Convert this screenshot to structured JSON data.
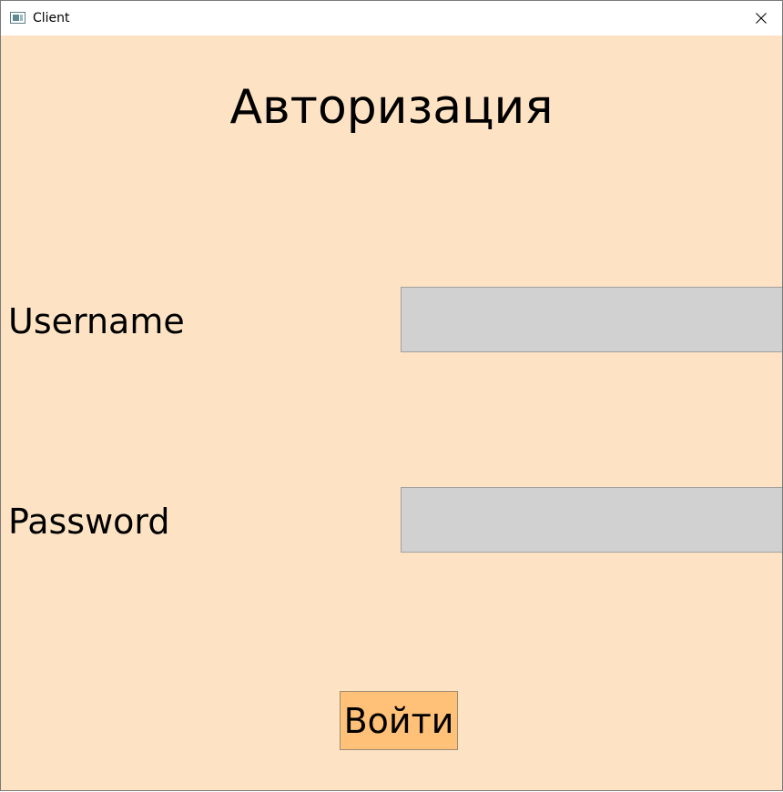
{
  "window": {
    "title": "Client",
    "close_icon": "close-icon",
    "app_icon": "window-app-icon"
  },
  "form": {
    "heading": "Авторизация",
    "username_label": "Username",
    "username_value": "",
    "password_label": "Password",
    "password_value": "",
    "submit_label": "Войти"
  },
  "colors": {
    "background": "#fde3c4",
    "field_background": "#d1d1d1",
    "button_background": "#ffc077"
  }
}
